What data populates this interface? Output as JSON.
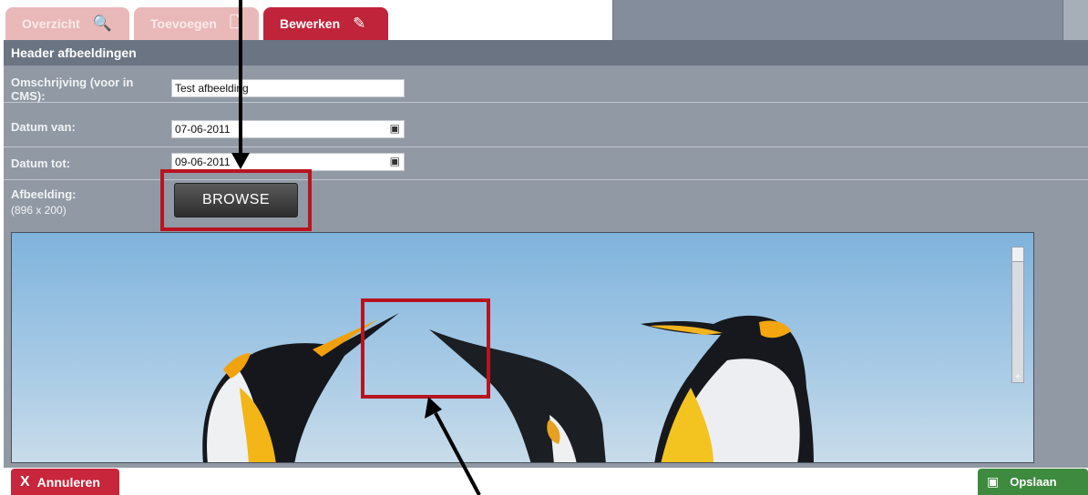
{
  "tabs": [
    {
      "label": "Overzicht",
      "icon": "search-document-icon"
    },
    {
      "label": "Toevoegen",
      "icon": "add-page-icon"
    },
    {
      "label": "Bewerken",
      "icon": "edit-icon"
    }
  ],
  "panel": {
    "title": "Header afbeeldingen",
    "fields": {
      "description": {
        "label": "Omschrijving (voor in CMS):",
        "value": "Test afbeelding"
      },
      "date_from": {
        "label": "Datum van:",
        "value": "07-06-2011"
      },
      "date_to": {
        "label": "Datum tot:",
        "value": "09-06-2011"
      }
    },
    "image": {
      "label": "Afbeelding:",
      "dimensions": "(896 x 200)",
      "browse_label": "BROWSE"
    }
  },
  "actions": {
    "cancel_label": "Annuleren",
    "save_label": "Opslaan"
  },
  "colors": {
    "active_tab": "#c0243a",
    "inactive_tab": "#e9b8b8",
    "panel": "#9199a4",
    "panel_header": "#6a7482",
    "cancel": "#c8263b",
    "save": "#3e8a3f",
    "annotation_red": "#b8141f"
  }
}
